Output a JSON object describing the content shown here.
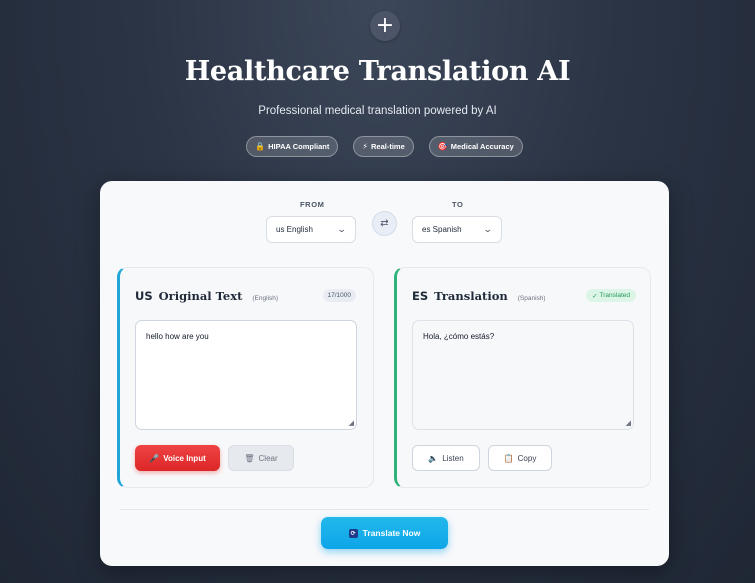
{
  "header": {
    "plus_glyph": "+",
    "title": "Healthcare Translation AI",
    "subtitle": "Professional medical translation powered by AI",
    "badges": [
      {
        "icon": "lock-icon",
        "label": "HIPAA Compliant"
      },
      {
        "icon": "lightning-icon",
        "label": "Real-time"
      },
      {
        "icon": "target-icon",
        "label": "Medical Accuracy"
      }
    ]
  },
  "languages": {
    "from_label": "FROM",
    "to_label": "TO",
    "from_value": "us English",
    "to_value": "es Spanish",
    "swap_glyph": "⇄"
  },
  "source": {
    "flag": "US",
    "title": "Original Text",
    "lang": "(English)",
    "counter": "17/1000",
    "text": "hello how are you",
    "voice_label": "Voice Input",
    "clear_label": "Clear"
  },
  "target": {
    "flag": "ES",
    "title": "Translation",
    "lang": "(Spanish)",
    "status": "Translated",
    "text": "Hola, ¿cómo estás?",
    "listen_label": "Listen",
    "copy_label": "Copy"
  },
  "actions": {
    "translate_label": "Translate Now"
  },
  "colors": {
    "accent_blue": "#0ea5e9",
    "accent_green": "#2fb37a",
    "voice_red": "#dc2626"
  }
}
